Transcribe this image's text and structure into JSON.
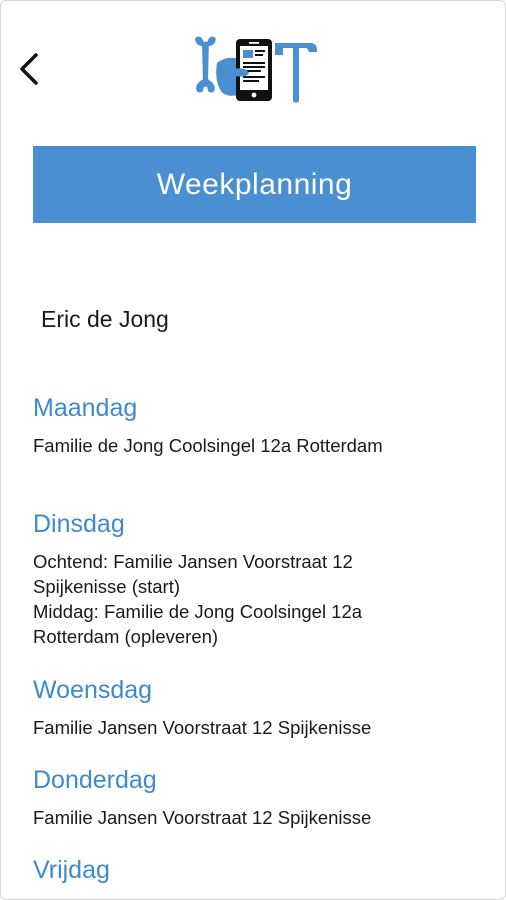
{
  "header": {
    "back_icon": "chevron-left-icon",
    "logo_icon": "handyman-app-logo-icon",
    "accent_color": "#4a8fd2",
    "title": "Weekplanning"
  },
  "user": {
    "name": "Eric de Jong"
  },
  "days": [
    {
      "name": "Maandag",
      "lines": [
        "Familie de Jong Coolsingel 12a Rotterdam"
      ]
    },
    {
      "name": "Dinsdag",
      "lines": [
        "Ochtend: Familie Jansen Voorstraat 12",
        "Spijkenisse (start)",
        "Middag: Familie de Jong Coolsingel 12a",
        "Rotterdam (opleveren)"
      ]
    },
    {
      "name": "Woensdag",
      "lines": [
        "Familie Jansen Voorstraat 12 Spijkenisse"
      ]
    },
    {
      "name": "Donderdag",
      "lines": [
        "Familie Jansen Voorstraat 12 Spijkenisse"
      ]
    },
    {
      "name": "Vrijdag",
      "lines": []
    }
  ]
}
